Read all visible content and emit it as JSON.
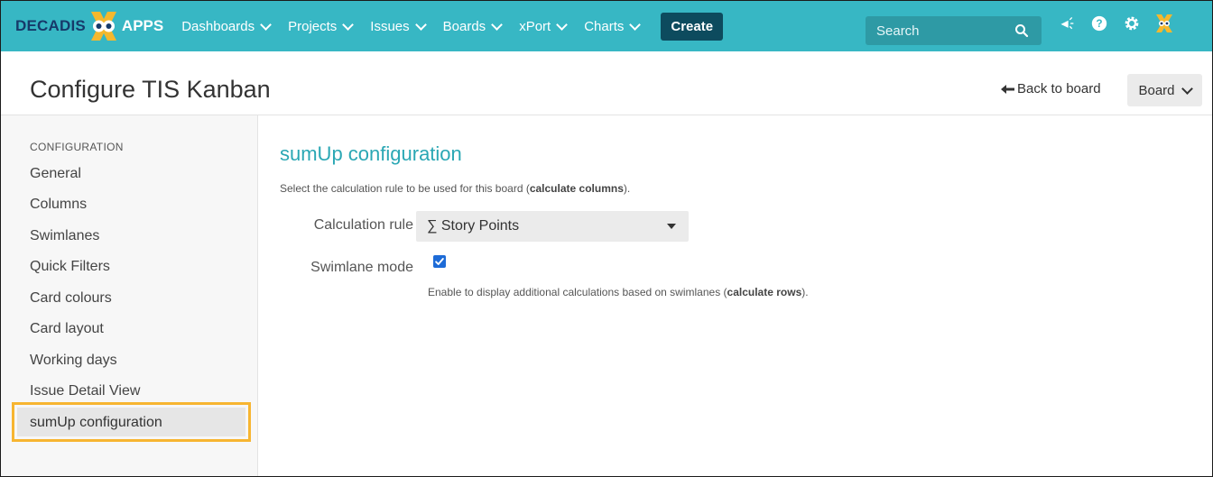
{
  "brand": {
    "left": "DECADIS",
    "right": "APPS"
  },
  "nav": {
    "items": [
      {
        "label": "Dashboards"
      },
      {
        "label": "Projects"
      },
      {
        "label": "Issues"
      },
      {
        "label": "Boards"
      },
      {
        "label": "xPort"
      },
      {
        "label": "Charts"
      }
    ],
    "create_label": "Create"
  },
  "search": {
    "placeholder": "Search"
  },
  "top_icons": [
    "megaphone-icon",
    "help-icon",
    "settings-icon",
    "user-avatar-icon"
  ],
  "header": {
    "title": "Configure TIS Kanban",
    "back_label": "Back to board",
    "board_label": "Board"
  },
  "sidebar": {
    "heading": "CONFIGURATION",
    "items": [
      {
        "label": "General"
      },
      {
        "label": "Columns"
      },
      {
        "label": "Swimlanes"
      },
      {
        "label": "Quick Filters"
      },
      {
        "label": "Card colours"
      },
      {
        "label": "Card layout"
      },
      {
        "label": "Working days"
      },
      {
        "label": "Issue Detail View"
      },
      {
        "label": "sumUp configuration"
      }
    ],
    "active_index": 8
  },
  "main": {
    "title": "sumUp configuration",
    "description_pre": "Select the calculation rule to be used for this board (",
    "description_bold": "calculate columns",
    "description_post": ").",
    "calc_rule_label": "Calculation rule",
    "calc_rule_value": "∑ Story Points",
    "swimlane_label": "Swimlane mode",
    "swimlane_checked": true,
    "swimlane_hint_pre": "Enable to display additional calculations based on swimlanes (",
    "swimlane_hint_bold": "calculate rows",
    "swimlane_hint_post": ")."
  },
  "colors": {
    "topbar": "#37b7c4",
    "create_button": "#0d4b5e",
    "accent_title": "#2aa7b4",
    "highlight_box": "#f7b531",
    "checkbox": "#1d6bd7"
  }
}
